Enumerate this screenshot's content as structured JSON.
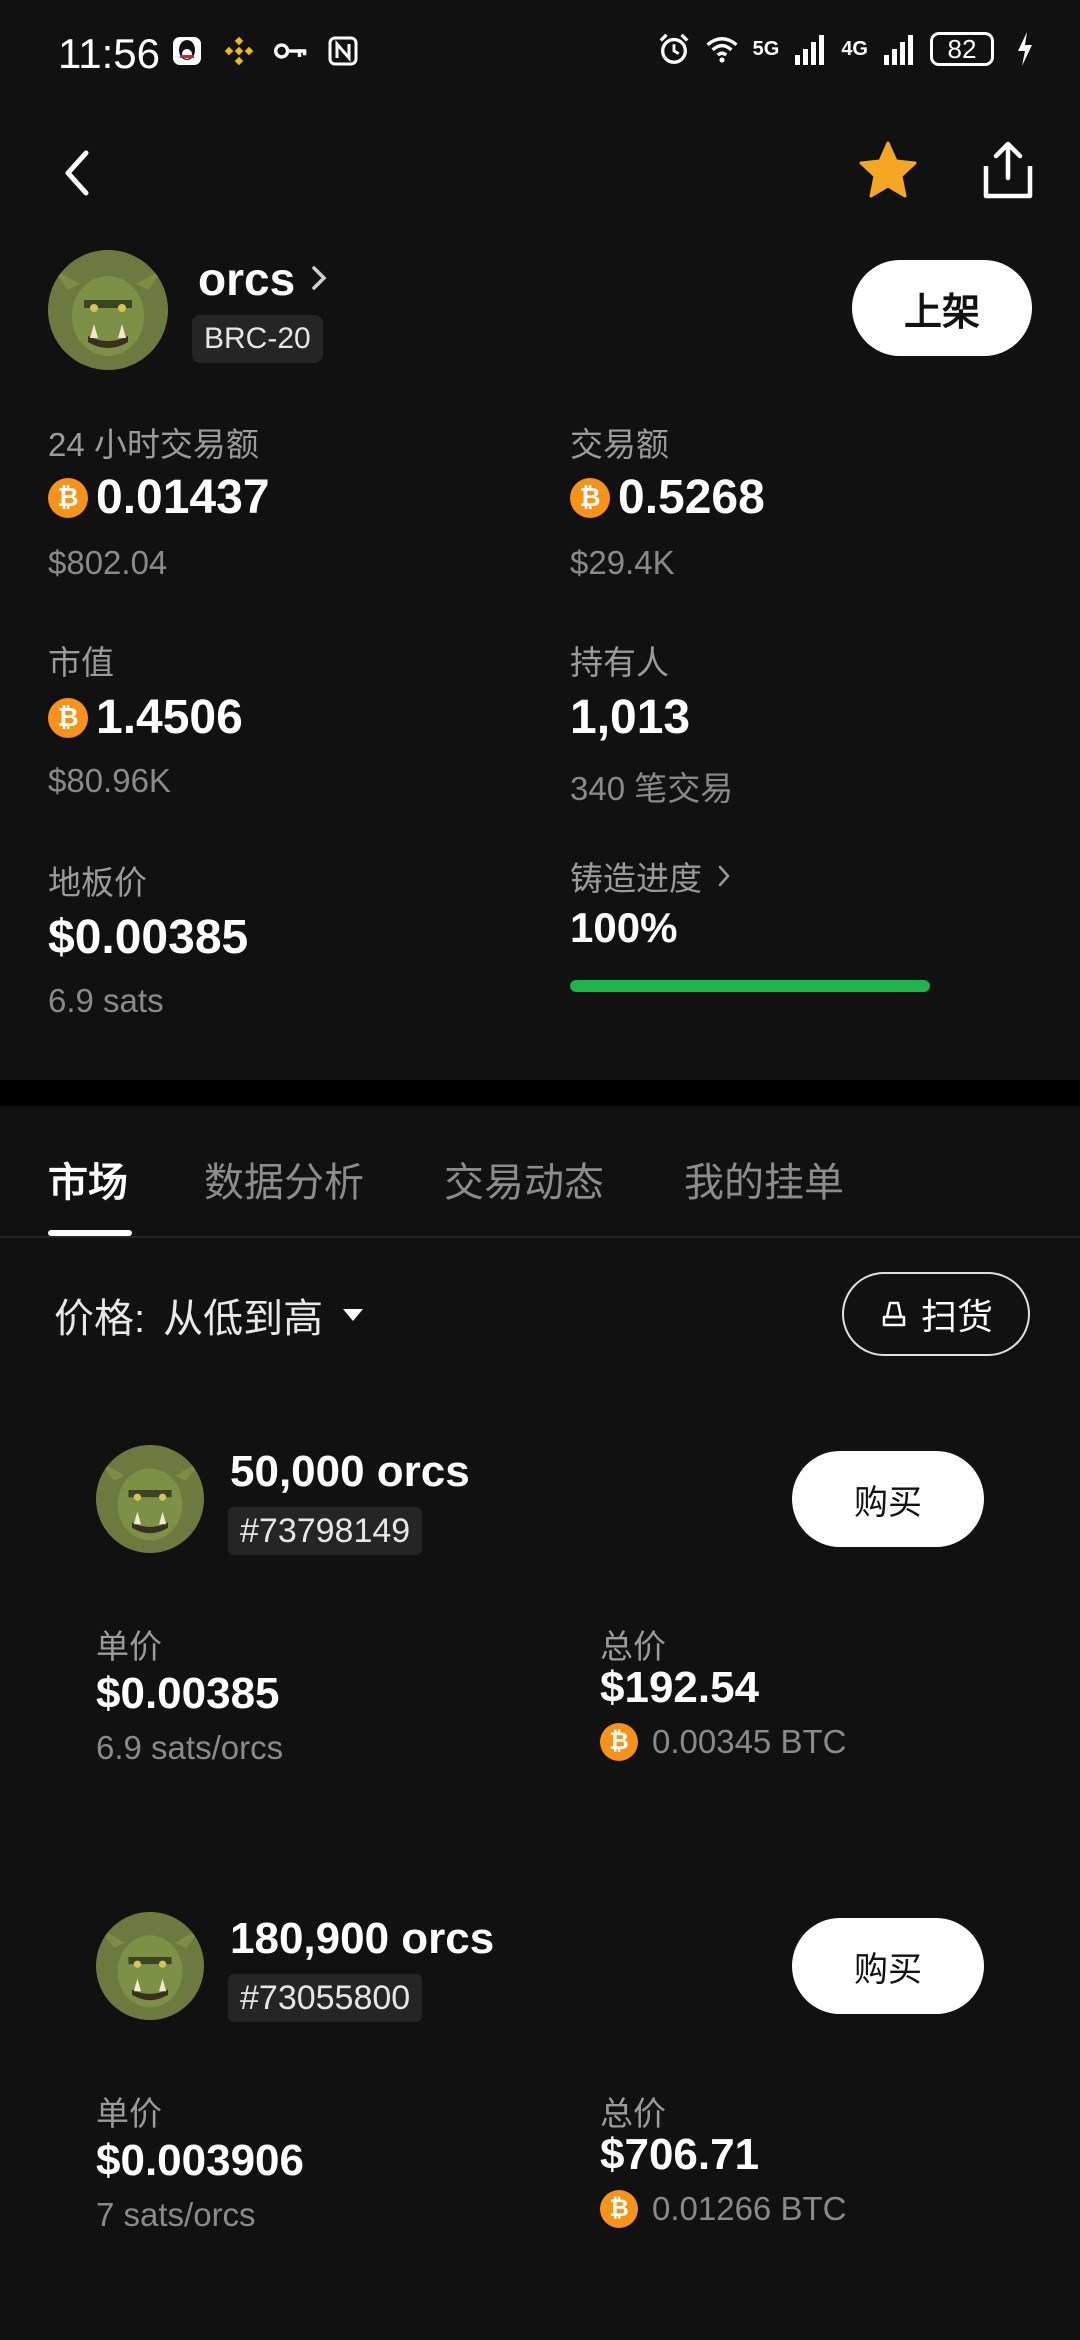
{
  "status_bar": {
    "time": "11:56",
    "signal_1": "5G",
    "signal_2": "4G",
    "battery": "82"
  },
  "header": {
    "token_name": "orcs",
    "token_standard": "BRC-20",
    "list_button": "上架"
  },
  "stats": {
    "volume_24h": {
      "label": "24 小时交易额",
      "btc": "0.01437",
      "usd": "$802.04"
    },
    "volume_total": {
      "label": "交易额",
      "btc": "0.5268",
      "usd": "$29.4K"
    },
    "market_cap": {
      "label": "市值",
      "btc": "1.4506",
      "usd": "$80.96K"
    },
    "holders": {
      "label": "持有人",
      "value": "1,013",
      "sub": "340 笔交易"
    },
    "floor": {
      "label": "地板价",
      "value": "$0.00385",
      "sub": "6.9 sats"
    },
    "mint": {
      "label": "铸造进度",
      "value": "100%",
      "progress": 1.0
    }
  },
  "tabs": [
    "市场",
    "数据分析",
    "交易动态",
    "我的挂单"
  ],
  "sort": {
    "label": "价格:",
    "value": "从低到高"
  },
  "sweep_button": "扫货",
  "listings": [
    {
      "quantity": "50,000 orcs",
      "id": "#73798149",
      "buy": "购买",
      "unit_label": "单价",
      "unit_price": "$0.00385",
      "unit_sats": "6.9 sats/orcs",
      "total_label": "总价",
      "total_usd": "$192.54",
      "total_btc": "0.00345 BTC"
    },
    {
      "quantity": "180,900 orcs",
      "id": "#73055800",
      "buy": "购买",
      "unit_label": "单价",
      "unit_price": "$0.003906",
      "unit_sats": "7 sats/orcs",
      "total_label": "总价",
      "total_usd": "$706.71",
      "total_btc": "0.01266 BTC"
    }
  ],
  "colors": {
    "background": "#111111",
    "bitcoin": "#f7931a",
    "progress": "#1fb44c",
    "star": "#f5a623"
  }
}
